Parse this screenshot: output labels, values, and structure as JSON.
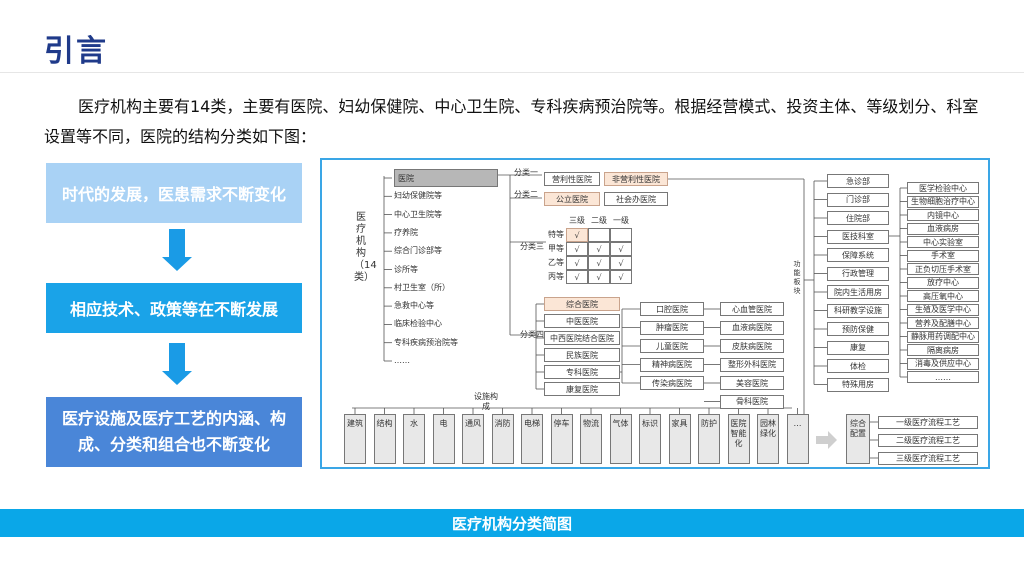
{
  "title": "引言",
  "intro": "医疗机构主要有14类，主要有医院、妇幼保健院、中心卫生院、专科疾病预治院等。根据经营模式、投资主体、等级划分、科室设置等不同，医院的结构分类如下图：",
  "flow": {
    "step1": "时代的发展，医患需求不断变化",
    "step2": "相应技术、政策等在不断发展",
    "step3": "医疗设施及医疗工艺的内涵、构成、分类和组合也不断变化"
  },
  "diagram": {
    "root_label": "医疗机构（14类）",
    "categories": [
      "医院",
      "妇幼保健院等",
      "中心卫生院等",
      "疗养院",
      "综合门诊部等",
      "诊所等",
      "村卫生室（所）",
      "急救中心等",
      "临床检验中心",
      "专科疾病预治院等",
      "……"
    ],
    "class1_label": "分类一",
    "class2_label": "分类二",
    "class3_label": "分类三",
    "class4_label": "分类四",
    "for_profit": "营利性医院",
    "non_profit": "非营利性医院",
    "public_hospital": "公立医院",
    "social_hospital": "社会办医院",
    "grade_headers": [
      "三级",
      "二级",
      "一级"
    ],
    "grade_rows": [
      {
        "label": "特等",
        "marks": [
          "√",
          "",
          ""
        ]
      },
      {
        "label": "甲等",
        "marks": [
          "√",
          "√",
          "√"
        ]
      },
      {
        "label": "乙等",
        "marks": [
          "√",
          "√",
          "√"
        ]
      },
      {
        "label": "丙等",
        "marks": [
          "√",
          "√",
          "√"
        ]
      }
    ],
    "general_types": [
      "综合医院",
      "中医医院",
      "中西医院结合医院",
      "民族医院",
      "专科医院",
      "康复医院"
    ],
    "specialty_col1": [
      "口腔医院",
      "肿瘤医院",
      "儿童医院",
      "精神病医院",
      "传染病医院"
    ],
    "specialty_col2": [
      "心血管医院",
      "血液病医院",
      "皮肤病医院",
      "整形外科医院",
      "美容医院",
      "骨科医院"
    ],
    "function_label": "功能板块",
    "departments": [
      "急诊部",
      "门诊部",
      "住院部",
      "医技科室",
      "保障系统",
      "行政管理",
      "院内生活用房",
      "科研教学设施",
      "预防保健",
      "康复",
      "体检",
      "特殊用房"
    ],
    "tech_units": [
      "医学检验中心",
      "生物细胞治疗中心",
      "内镜中心",
      "血液病房",
      "中心实验室",
      "手术室",
      "正负切压手术室",
      "放疗中心",
      "高压氧中心",
      "生殖及医学中心",
      "营养及配膳中心",
      "静脉用药调配中心",
      "隔离病房",
      "消毒及供应中心",
      "……"
    ],
    "facility_label": "设施构成",
    "facilities": [
      "建筑",
      "结构",
      "水",
      "电",
      "通风",
      "消防",
      "电梯",
      "停车",
      "物流",
      "气体",
      "标识",
      "家具",
      "防护",
      "医院智能化",
      "园林绿化",
      "…"
    ],
    "integrated_label": "综合配置",
    "process_levels": [
      "一级医疗流程工艺",
      "二级医疗流程工艺",
      "三级医疗流程工艺"
    ]
  },
  "caption": "医疗机构分类简图",
  "colors": {
    "accent": "#1aa3e8",
    "title": "#1f3a8a",
    "highlight": "#fbe6d6"
  }
}
